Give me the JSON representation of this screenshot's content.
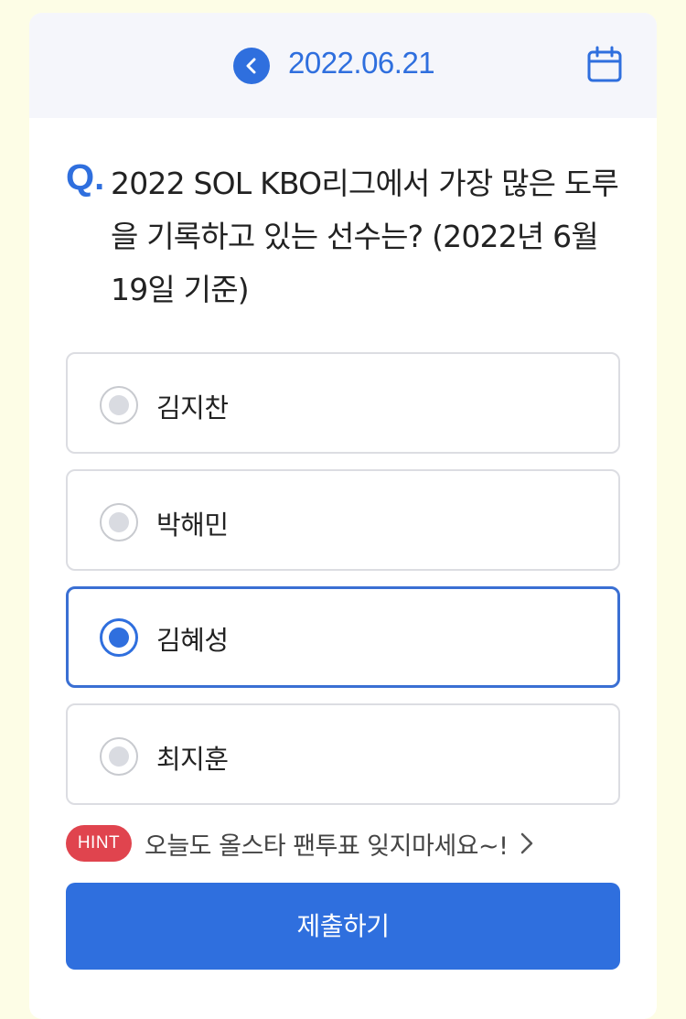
{
  "header": {
    "date": "2022.06.21",
    "prev_icon": "chevron-left-icon",
    "calendar_icon": "calendar-icon"
  },
  "question": {
    "marker": "Q.",
    "text": "2022 SOL KBO리그에서 가장 많은 도루을 기록하고 있는 선수는? (2022년 6월 19일 기준)"
  },
  "options": [
    {
      "label": "김지찬",
      "selected": false
    },
    {
      "label": "박해민",
      "selected": false
    },
    {
      "label": "김혜성",
      "selected": true
    },
    {
      "label": "최지훈",
      "selected": false
    }
  ],
  "hint": {
    "badge": "HINT",
    "text": "오늘도 올스타 팬투표 잊지마세요~!",
    "arrow_icon": "chevron-right-icon"
  },
  "submit_label": "제출하기",
  "colors": {
    "accent": "#2f6fde",
    "hint_badge": "#e0444e",
    "background": "#fdfde6"
  }
}
